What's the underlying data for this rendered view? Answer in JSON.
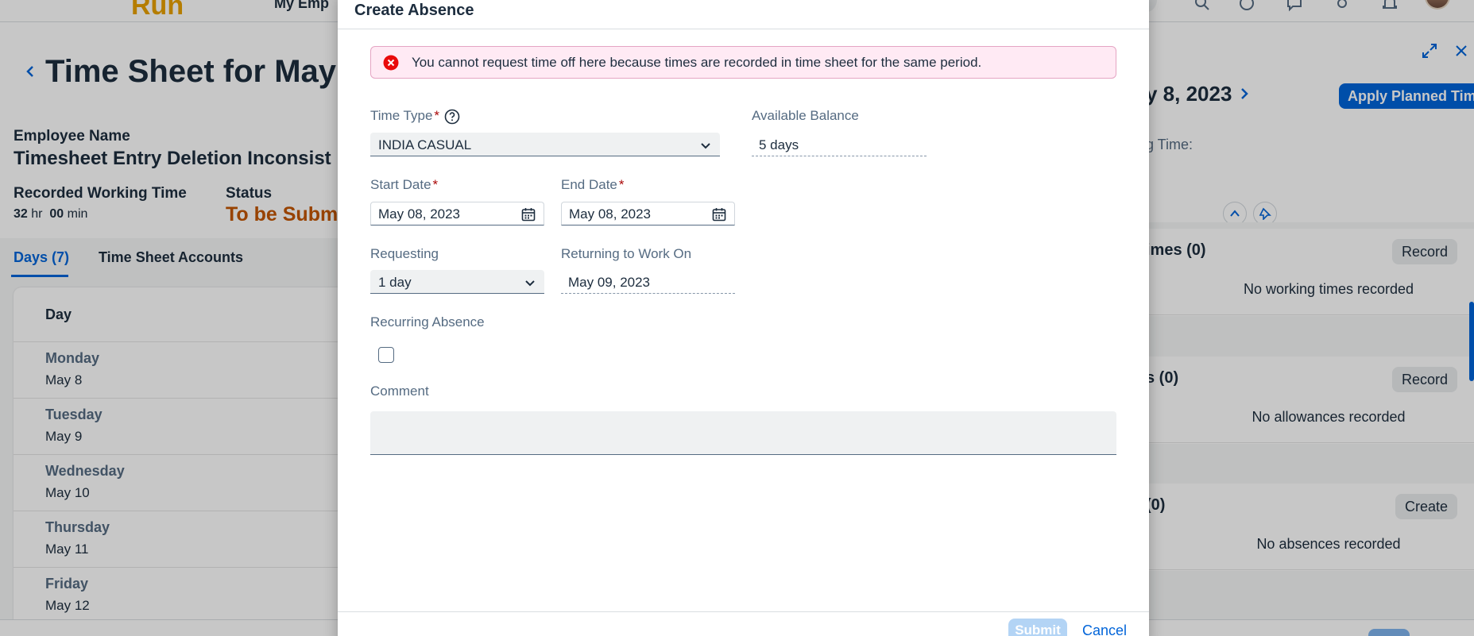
{
  "shell": {
    "logo": "Run",
    "nav_label": "My Emp",
    "icons": [
      "search-icon",
      "help-icon",
      "notification-icon",
      "settings-icon",
      "bell-icon"
    ]
  },
  "page": {
    "title": "Time Sheet for May",
    "employee_label": "Employee Name",
    "employee_name": "Timesheet Entry Deletion Inconsist",
    "recorded_label": "Recorded Working Time",
    "recorded_hours": "32",
    "recorded_hours_unit": "hr",
    "recorded_minutes": "00",
    "recorded_minutes_unit": "min",
    "status_label": "Status",
    "status_value": "To be Subm"
  },
  "tabs": {
    "days": "Days (7)",
    "accounts": "Time Sheet Accounts"
  },
  "days_table": {
    "header": "Day",
    "rows": [
      {
        "name": "Monday",
        "date": "May 8"
      },
      {
        "name": "Tuesday",
        "date": "May 9"
      },
      {
        "name": "Wednesday",
        "date": "May 10"
      },
      {
        "name": "Thursday",
        "date": "May 11"
      },
      {
        "name": "Friday",
        "date": "May 12"
      }
    ]
  },
  "right_panel": {
    "date": "y 8, 2023",
    "apply_button": "Apply Planned Time",
    "working_time_label": "g Time:",
    "cards": [
      {
        "title": "imes (0)",
        "button": "Record",
        "empty": "No working times recorded"
      },
      {
        "title": "s (0)",
        "button": "Record",
        "empty": "No allowances recorded"
      },
      {
        "title": "(0)",
        "button": "Create",
        "empty": "No absences recorded"
      }
    ]
  },
  "dialog": {
    "title": "Create Absence",
    "error_message": "You cannot request time off here because times are recorded in time sheet for the same period.",
    "time_type_label": "Time Type",
    "time_type_value": "INDIA CASUAL",
    "available_balance_label": "Available Balance",
    "available_balance_value": "5 days",
    "start_date_label": "Start Date",
    "start_date_value": "May 08, 2023",
    "end_date_label": "End Date",
    "end_date_value": "May 08, 2023",
    "requesting_label": "Requesting",
    "requesting_value": "1 day",
    "returning_label": "Returning to Work On",
    "returning_value": "May 09, 2023",
    "recurring_label": "Recurring Absence",
    "comment_label": "Comment",
    "required_marker": "*",
    "submit_label": "Submit",
    "cancel_label": "Cancel"
  },
  "colors": {
    "accent": "#0064d9",
    "status_warning": "#c35500",
    "error_background": "#ffeaf4",
    "error_icon": "#e90b0b",
    "required": "#aa0808"
  }
}
